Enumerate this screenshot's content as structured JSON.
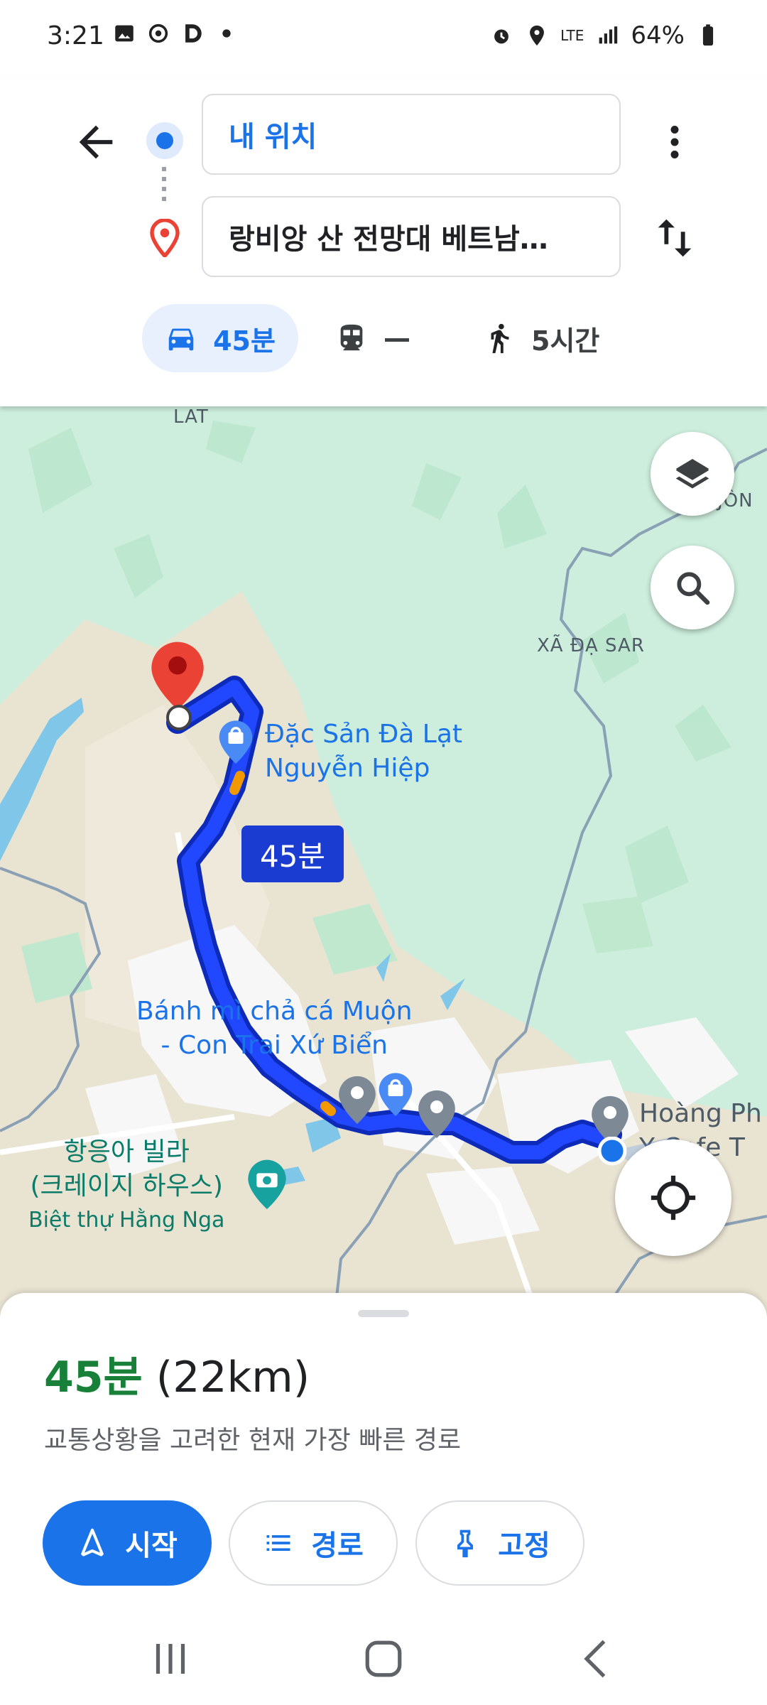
{
  "status_bar": {
    "time": "3:21",
    "battery": "64%",
    "network": "LTE"
  },
  "directions": {
    "origin": "내 위치",
    "destination": "랑비앙 산 전망대 베트남…",
    "modes": [
      {
        "name": "car-icon",
        "label": "45분"
      },
      {
        "name": "transit-icon",
        "label": "—"
      },
      {
        "name": "walk-icon",
        "label": "5시간"
      }
    ]
  },
  "map": {
    "labels": {
      "lat": "LAT",
      "don": "JÔN",
      "xa_da_sar": "XÃ ĐẠ SAR"
    },
    "pois": {
      "dac_san_1": "Đặc Sản Đà Lạt",
      "dac_san_2": "Nguyễn Hiệp",
      "banh_mi_1": "Bánh mì chả cá Muộn",
      "banh_mi_2": "- Con Trai Xứ Biển",
      "villa_1": "항응아 빌라",
      "villa_2": "(크레이지 하우스)",
      "villa_3": "Biệt thự Hằng Nga",
      "hoang_1": "Hoàng Ph",
      "hoang_2": "Y  Cafe T"
    },
    "route_eta": "45분",
    "colors": {
      "route": "#1a3cd0",
      "route_edge": "#0d2bb8",
      "dest_pin": "#ea4335"
    }
  },
  "sheet": {
    "duration": "45분",
    "distance": "(22km)",
    "description": "교통상황을 고려한 현재 가장 빠른 경로",
    "buttons": {
      "start": "시작",
      "steps": "경로",
      "pin": "고정"
    }
  }
}
